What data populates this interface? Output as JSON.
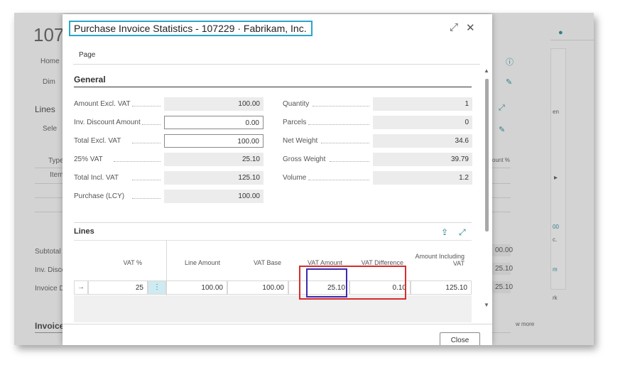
{
  "background": {
    "page_number": "107",
    "home_label": "Home",
    "dim_label": "Dim",
    "lines_label": "Lines",
    "sel_label": "Sele",
    "type_label": "Type",
    "item_label": "Item",
    "subtotal_label": "Subtotal",
    "inv_disc_label": "Inv. Disco",
    "invoice_d_label": "Invoice D",
    "invoice_label": "Invoice",
    "right_col_header": "ount %",
    "right_vals": [
      "00.00",
      "25.10",
      "25.10"
    ],
    "right_texts": [
      "en",
      "00",
      "c.",
      "m",
      "rk"
    ],
    "see_more": "w more"
  },
  "dialog": {
    "title": "Purchase Invoice Statistics - 107229 · Fabrikam, Inc.",
    "menu_page": "Page",
    "general_header": "General",
    "left_fields": [
      {
        "label": "Amount Excl. VAT",
        "value": "100.00"
      },
      {
        "label": "Inv. Discount Amount",
        "value": "0.00"
      },
      {
        "label": "Total Excl. VAT",
        "value": "100.00"
      },
      {
        "label": "25% VAT",
        "value": "25.10"
      },
      {
        "label": "Total Incl. VAT",
        "value": "125.10"
      },
      {
        "label": "Purchase (LCY)",
        "value": "100.00"
      }
    ],
    "right_fields": [
      {
        "label": "Quantity",
        "value": "1"
      },
      {
        "label": "Parcels",
        "value": "0"
      },
      {
        "label": "Net Weight",
        "value": "34.6"
      },
      {
        "label": "Gross Weight",
        "value": "39.79"
      },
      {
        "label": "Volume",
        "value": "1.2"
      }
    ],
    "lines_header": "Lines",
    "table": {
      "headers": [
        "VAT %",
        "Line Amount",
        "VAT Base",
        "VAT Amount",
        "VAT Difference",
        "Amount Including VAT"
      ],
      "row": [
        "25",
        "100.00",
        "100.00",
        "25.10",
        "0.10",
        "125.10"
      ]
    },
    "close_label": "Close"
  },
  "colors": {
    "accent": "#1a7f8f",
    "highlight_red": "#d92b2b",
    "highlight_blue": "#3b2bb0",
    "title_border": "#2aa7c9"
  }
}
